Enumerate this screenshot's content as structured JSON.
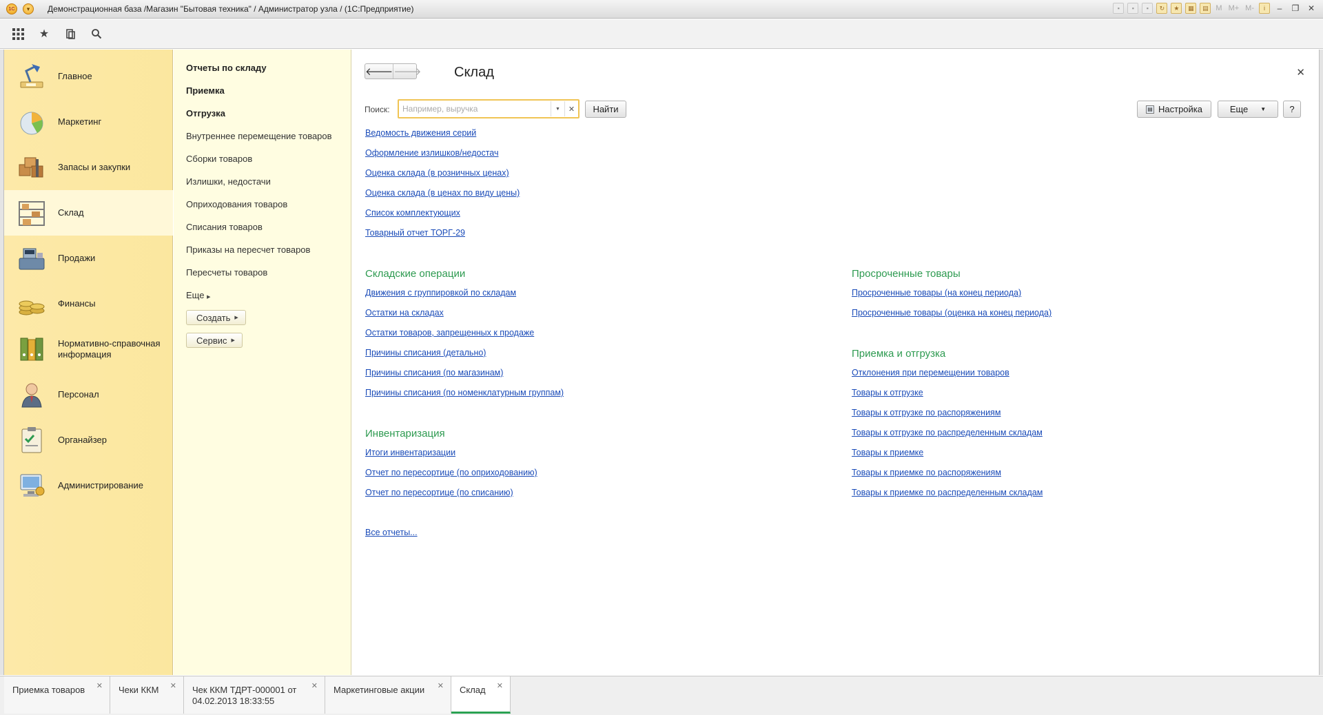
{
  "window": {
    "title": "Демонстрационная база /Магазин \"Бытовая техника\" / Администратор узла /  (1С:Предприятие)",
    "right_text": [
      "M",
      "M+",
      "M-"
    ]
  },
  "sections": [
    {
      "label": "Главное",
      "icon": "desk-lamp-icon",
      "active": false
    },
    {
      "label": "Маркетинг",
      "icon": "pie-chart-icon",
      "active": false
    },
    {
      "label": "Запасы и закупки",
      "icon": "boxes-truck-icon",
      "active": false
    },
    {
      "label": "Склад",
      "icon": "warehouse-shelf-icon",
      "active": true
    },
    {
      "label": "Продажи",
      "icon": "cash-register-icon",
      "active": false
    },
    {
      "label": "Финансы",
      "icon": "coins-icon",
      "active": false
    },
    {
      "label": "Нормативно-справочная информация",
      "icon": "binders-icon",
      "active": false
    },
    {
      "label": "Персонал",
      "icon": "person-icon",
      "active": false
    },
    {
      "label": "Органайзер",
      "icon": "clipboard-icon",
      "active": false
    },
    {
      "label": "Администрирование",
      "icon": "computer-icon",
      "active": false
    }
  ],
  "navigation": {
    "bold_items": [
      "Отчеты по складу",
      "Приемка",
      "Отгрузка"
    ],
    "items": [
      "Внутреннее перемещение товаров",
      "Сборки товаров",
      "Излишки, недостачи",
      "Оприходования товаров",
      "Списания товаров",
      "Приказы на пересчет товаров",
      "Пересчеты товаров"
    ],
    "more": "Еще",
    "create_button": "Создать",
    "service_button": "Сервис"
  },
  "main": {
    "title": "Склад",
    "search": {
      "label": "Поиск:",
      "placeholder": "Например, выручка",
      "find_button": "Найти"
    },
    "settings_button": "Настройка",
    "more_button": "Еще",
    "help_button": "?",
    "top_links": [
      "Ведомость движения серий",
      "Оформление излишков/недостач",
      "Оценка склада (в розничных ценах)",
      "Оценка склада (в ценах по виду цены)",
      "Список комплектующих",
      "Товарный отчет ТОРГ-29"
    ],
    "groups_left": [
      {
        "title": "Складские операции",
        "links": [
          "Движения с группировкой по складам",
          "Остатки на складах",
          "Остатки товаров, запрещенных к продаже",
          "Причины списания (детально)",
          "Причины списания (по магазинам)",
          "Причины списания (по номенклатурным группам)"
        ]
      },
      {
        "title": "Инвентаризация",
        "links": [
          "Итоги инвентаризации",
          "Отчет по пересортице (по оприходованию)",
          "Отчет по пересортице (по списанию)"
        ]
      }
    ],
    "groups_right": [
      {
        "title": "Просроченные товары",
        "links": [
          "Просроченные товары (на конец периода)",
          "Просроченные товары (оценка на конец периода)"
        ]
      },
      {
        "title": "Приемка и отгрузка",
        "links": [
          "Отклонения при перемещении товаров",
          "Товары к отгрузке",
          "Товары к отгрузке по распоряжениям",
          "Товары к отгрузке по распределенным складам",
          "Товары к приемке",
          "Товары к приемке по распоряжениям",
          "Товары к приемке по распределенным складам"
        ]
      }
    ],
    "all_reports": "Все отчеты..."
  },
  "tabs": [
    {
      "label": "Приемка товаров",
      "active": false
    },
    {
      "label": "Чеки ККМ",
      "active": false
    },
    {
      "label": "Чек ККМ ТДРТ-000001 от 04.02.2013 18:33:55",
      "active": false
    },
    {
      "label": "Маркетинговые акции",
      "active": false
    },
    {
      "label": "Склад",
      "active": true
    }
  ],
  "colors": {
    "accent_green": "#2d9a50",
    "link_blue": "#1a4bb8",
    "sections_bg": "#fde9a8",
    "nav_bg": "#fffde1",
    "search_border": "#f0c454"
  }
}
